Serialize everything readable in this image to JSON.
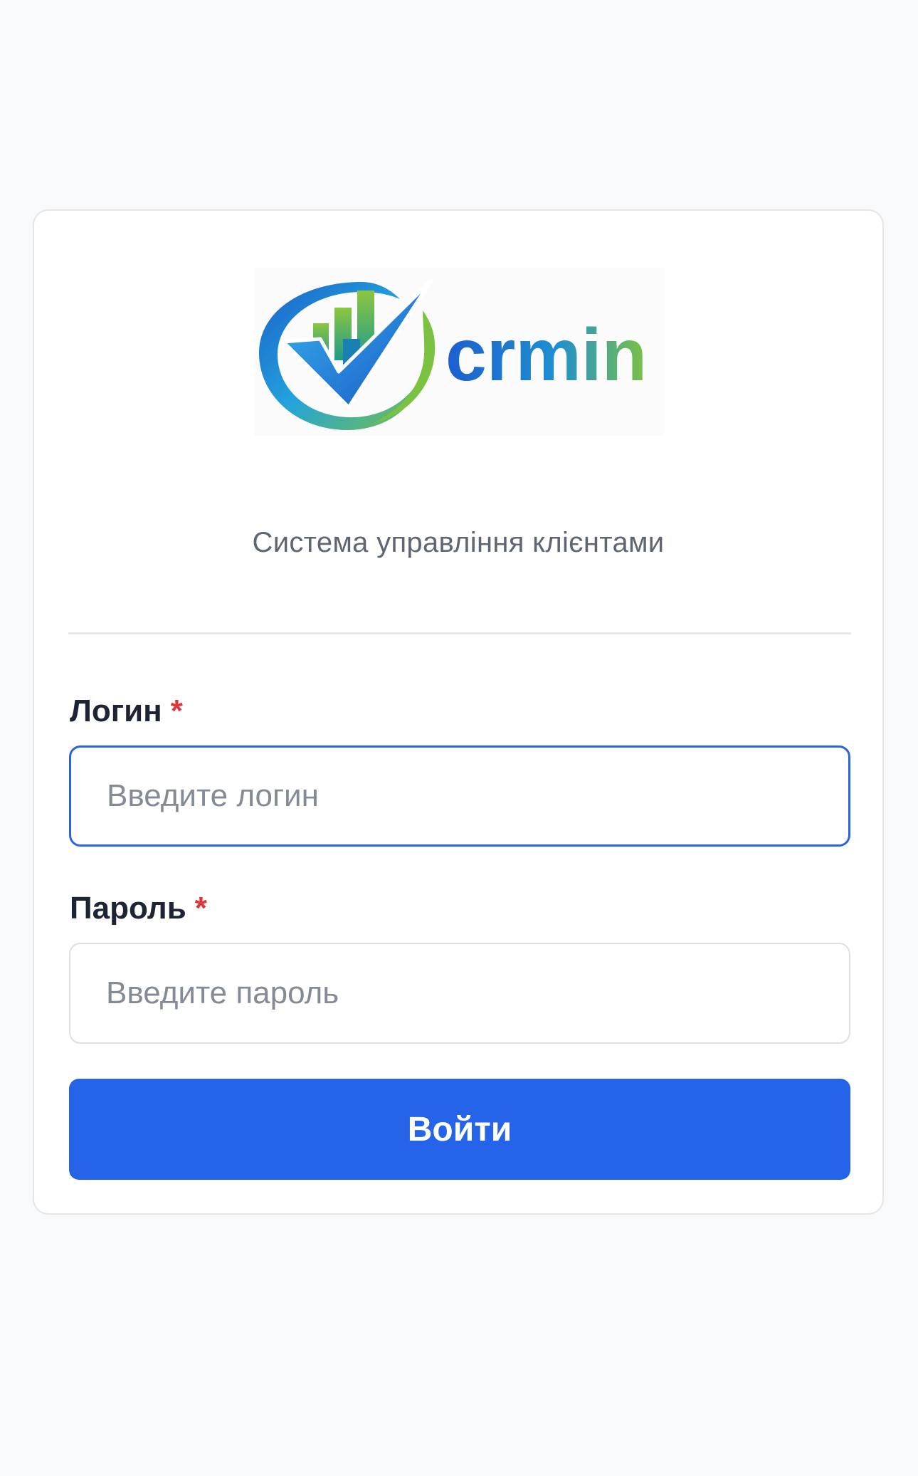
{
  "brand": {
    "logo_text": "crmin",
    "subtitle": "Система управління клієнтами"
  },
  "form": {
    "login": {
      "label": "Логин",
      "required_mark": "*",
      "placeholder": "Введите логин",
      "value": ""
    },
    "password": {
      "label": "Пароль",
      "required_mark": "*",
      "placeholder": "Введите пароль",
      "value": ""
    },
    "submit_label": "Войти"
  },
  "colors": {
    "background": "#f8f9fb",
    "primary": "#2563e8",
    "required": "#e0353b",
    "focus_border": "#2c63de"
  }
}
